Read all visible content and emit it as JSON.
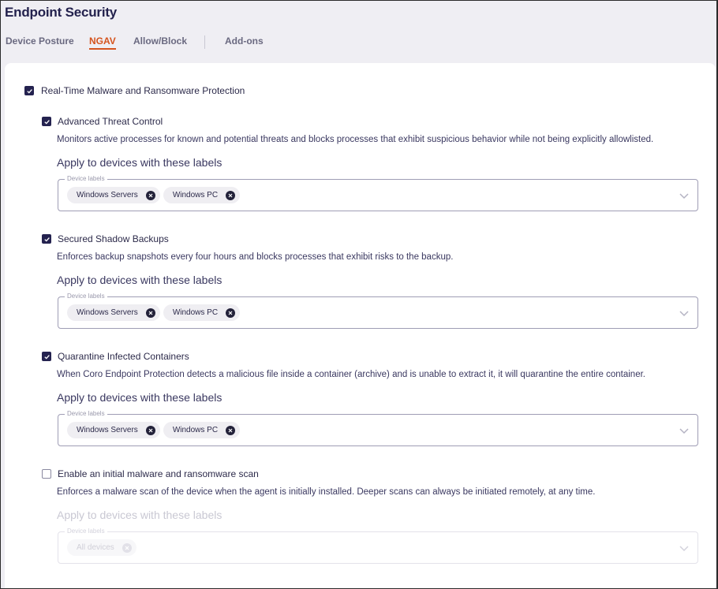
{
  "header": {
    "title": "Endpoint Security"
  },
  "tabs": [
    {
      "label": "Device Posture",
      "active": false
    },
    {
      "label": "NGAV",
      "active": true
    },
    {
      "label": "Allow/Block",
      "active": false
    },
    {
      "label": "Add-ons",
      "active": false
    }
  ],
  "colors": {
    "accent": "#d5531d",
    "primary": "#24224f",
    "background": "#efeef3"
  },
  "main": {
    "master": {
      "label": "Real-Time Malware and Ransomware Protection",
      "checked": true
    },
    "sections": [
      {
        "label": "Advanced Threat Control",
        "checked": true,
        "description": "Monitors active processes for known and potential threats and blocks processes that exhibit suspicious behavior while not being explicitly allowlisted.",
        "apply_title": "Apply to devices with these labels",
        "field_label": "Device labels",
        "chips": [
          "Windows Servers",
          "Windows PC"
        ],
        "disabled": false
      },
      {
        "label": "Secured Shadow Backups",
        "checked": true,
        "description": "Enforces backup snapshots every four hours and blocks processes that exhibit risks to the backup.",
        "apply_title": "Apply to devices with these labels",
        "field_label": "Device labels",
        "chips": [
          "Windows Servers",
          "Windows PC"
        ],
        "disabled": false
      },
      {
        "label": "Quarantine Infected Containers",
        "checked": true,
        "description": "When Coro Endpoint Protection detects a malicious file inside a container (archive) and is unable to extract it, it will quarantine the entire container.",
        "apply_title": "Apply to devices with these labels",
        "field_label": "Device labels",
        "chips": [
          "Windows Servers",
          "Windows PC"
        ],
        "disabled": false
      },
      {
        "label": "Enable an initial malware and ransomware scan",
        "checked": false,
        "description": "Enforces a malware scan of the device when the agent is initially installed. Deeper scans can always be initiated remotely, at any time.",
        "apply_title": "Apply to devices with these labels",
        "field_label": "Device labels",
        "chips": [
          "All devices"
        ],
        "disabled": true
      }
    ]
  }
}
